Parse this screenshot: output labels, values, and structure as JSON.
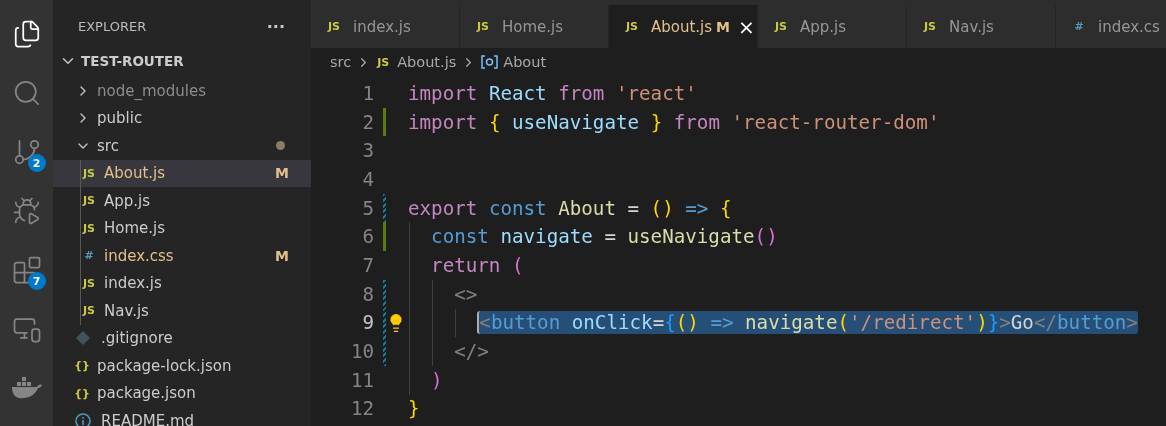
{
  "activity_bar": [
    {
      "kind": "files",
      "selected": true
    },
    {
      "kind": "search",
      "selected": false
    },
    {
      "kind": "source-control",
      "selected": false,
      "badge": "2"
    },
    {
      "kind": "run-debug",
      "selected": false
    },
    {
      "kind": "extensions",
      "selected": false,
      "badge": "7"
    },
    {
      "kind": "remote",
      "selected": false
    },
    {
      "kind": "docker",
      "selected": false
    }
  ],
  "sidebar": {
    "title": "EXPLORER",
    "more": "···",
    "project": {
      "name": "TEST-ROUTER",
      "expanded": true
    },
    "items": [
      {
        "label": "node_modules",
        "kind": "folder",
        "expanded": false,
        "ignored": true,
        "modified": false,
        "selected": false
      },
      {
        "label": "public",
        "kind": "folder",
        "expanded": false,
        "ignored": false,
        "modified": false,
        "selected": false
      },
      {
        "label": "src",
        "kind": "folder",
        "expanded": true,
        "ignored": false,
        "modified": true,
        "selected": false,
        "children": [
          {
            "label": "About.js",
            "kind": "js",
            "icon": "JS",
            "modified": true,
            "badge": "M",
            "selected": true
          },
          {
            "label": "App.js",
            "kind": "js",
            "icon": "JS",
            "modified": false,
            "selected": false
          },
          {
            "label": "Home.js",
            "kind": "js",
            "icon": "JS",
            "modified": false,
            "selected": false
          },
          {
            "label": "index.css",
            "kind": "css",
            "icon": "#",
            "modified": true,
            "badge": "M",
            "selected": false
          },
          {
            "label": "index.js",
            "kind": "js",
            "icon": "JS",
            "modified": false,
            "selected": false
          },
          {
            "label": "Nav.js",
            "kind": "js",
            "icon": "JS",
            "modified": false,
            "selected": false
          }
        ]
      },
      {
        "label": ".gitignore",
        "kind": "git",
        "modified": false,
        "selected": false
      },
      {
        "label": "package-lock.json",
        "kind": "json",
        "icon": "{}",
        "modified": false,
        "selected": false
      },
      {
        "label": "package.json",
        "kind": "json",
        "icon": "{}",
        "modified": false,
        "selected": false
      },
      {
        "label": "README.md",
        "kind": "info",
        "modified": false,
        "selected": false
      }
    ]
  },
  "tabs": [
    {
      "label": "index.js",
      "kind": "js",
      "icon": "JS",
      "selected": false,
      "modified": false
    },
    {
      "label": "Home.js",
      "kind": "js",
      "icon": "JS",
      "selected": false,
      "modified": false
    },
    {
      "label": "About.js",
      "kind": "js",
      "icon": "JS",
      "selected": true,
      "modified": true,
      "badge": "M",
      "close": "×"
    },
    {
      "label": "App.js",
      "kind": "js",
      "icon": "JS",
      "selected": false,
      "modified": false
    },
    {
      "label": "Nav.js",
      "kind": "js",
      "icon": "JS",
      "selected": false,
      "modified": false
    },
    {
      "label": "index.cs",
      "kind": "css",
      "icon": "#",
      "selected": false,
      "modified": false
    }
  ],
  "breadcrumb": {
    "folder": "src",
    "file_icon": "JS",
    "file": "About.js",
    "symbol": "About"
  },
  "code": [
    {
      "number": "1",
      "added": false,
      "modified": false,
      "current": false,
      "selected": false,
      "lightbulb": false,
      "tokens": [
        {
          "text": "import ",
          "kind": "keyword"
        },
        {
          "text": "React ",
          "kind": "variable"
        },
        {
          "text": "from ",
          "kind": "keyword"
        },
        {
          "text": "'react'",
          "kind": "string"
        }
      ]
    },
    {
      "number": "2",
      "added": true,
      "modified": false,
      "current": false,
      "selected": false,
      "lightbulb": false,
      "tokens": [
        {
          "text": "import ",
          "kind": "keyword"
        },
        {
          "text": "{",
          "kind": "bracket1"
        },
        {
          "text": " useNavigate ",
          "kind": "variable"
        },
        {
          "text": "} ",
          "kind": "bracket1"
        },
        {
          "text": "from ",
          "kind": "keyword"
        },
        {
          "text": "'react-router-dom'",
          "kind": "string"
        }
      ]
    },
    {
      "number": "3",
      "added": false,
      "modified": false,
      "current": false,
      "selected": false,
      "lightbulb": false
    },
    {
      "number": "4",
      "added": false,
      "modified": false,
      "current": false,
      "selected": false,
      "lightbulb": false
    },
    {
      "number": "5",
      "added": false,
      "modified": true,
      "current": false,
      "selected": false,
      "lightbulb": false,
      "tokens": [
        {
          "text": "export ",
          "kind": "keyword"
        },
        {
          "text": "const ",
          "kind": "storage"
        },
        {
          "text": "About",
          "kind": "function"
        },
        {
          "text": " = ",
          "kind": "plain"
        },
        {
          "text": "() ",
          "kind": "bracket1"
        },
        {
          "text": "=> ",
          "kind": "storage"
        },
        {
          "text": "{",
          "kind": "bracket1"
        }
      ]
    },
    {
      "number": "6",
      "added": true,
      "modified": false,
      "current": false,
      "selected": false,
      "lightbulb": false,
      "tokens": [
        {
          "text": "  const ",
          "kind": "storage"
        },
        {
          "text": "navigate",
          "kind": "variable"
        },
        {
          "text": " = ",
          "kind": "plain"
        },
        {
          "text": "useNavigate",
          "kind": "function"
        },
        {
          "text": "()",
          "kind": "bracket2"
        }
      ]
    },
    {
      "number": "7",
      "added": false,
      "modified": false,
      "current": false,
      "selected": false,
      "lightbulb": false,
      "tokens": [
        {
          "text": "  return ",
          "kind": "keyword"
        },
        {
          "text": "(",
          "kind": "bracket2"
        }
      ]
    },
    {
      "number": "8",
      "added": false,
      "modified": true,
      "current": false,
      "selected": false,
      "lightbulb": false,
      "tokens": [
        {
          "text": "    <>",
          "kind": "punct"
        }
      ]
    },
    {
      "number": "9",
      "added": false,
      "modified": true,
      "current": true,
      "selected": true,
      "lightbulb": true,
      "tokens": [
        {
          "text": "      <",
          "kind": "punct"
        },
        {
          "text": "button ",
          "kind": "storage"
        },
        {
          "text": "onClick",
          "kind": "variable"
        },
        {
          "text": "=",
          "kind": "plain"
        },
        {
          "text": "{",
          "kind": "bracket3"
        },
        {
          "text": "() ",
          "kind": "bracket1"
        },
        {
          "text": "=> ",
          "kind": "storage"
        },
        {
          "text": "navigate",
          "kind": "function"
        },
        {
          "text": "(",
          "kind": "bracket1"
        },
        {
          "text": "'/redirect'",
          "kind": "string"
        },
        {
          "text": ")",
          "kind": "bracket1"
        },
        {
          "text": "}",
          "kind": "bracket3"
        },
        {
          "text": ">",
          "kind": "punct"
        },
        {
          "text": "Go",
          "kind": "plain"
        },
        {
          "text": "</",
          "kind": "punct"
        },
        {
          "text": "button",
          "kind": "storage"
        },
        {
          "text": ">",
          "kind": "punct"
        }
      ]
    },
    {
      "number": "10",
      "added": false,
      "modified": true,
      "current": false,
      "selected": false,
      "lightbulb": false,
      "tokens": [
        {
          "text": "    </>",
          "kind": "punct"
        }
      ]
    },
    {
      "number": "11",
      "added": false,
      "modified": false,
      "current": false,
      "selected": false,
      "lightbulb": false,
      "tokens": [
        {
          "text": "  )",
          "kind": "bracket2"
        }
      ]
    },
    {
      "number": "12",
      "added": false,
      "modified": false,
      "current": false,
      "selected": false,
      "lightbulb": false,
      "tokens": [
        {
          "text": "}",
          "kind": "bracket1"
        }
      ]
    }
  ]
}
